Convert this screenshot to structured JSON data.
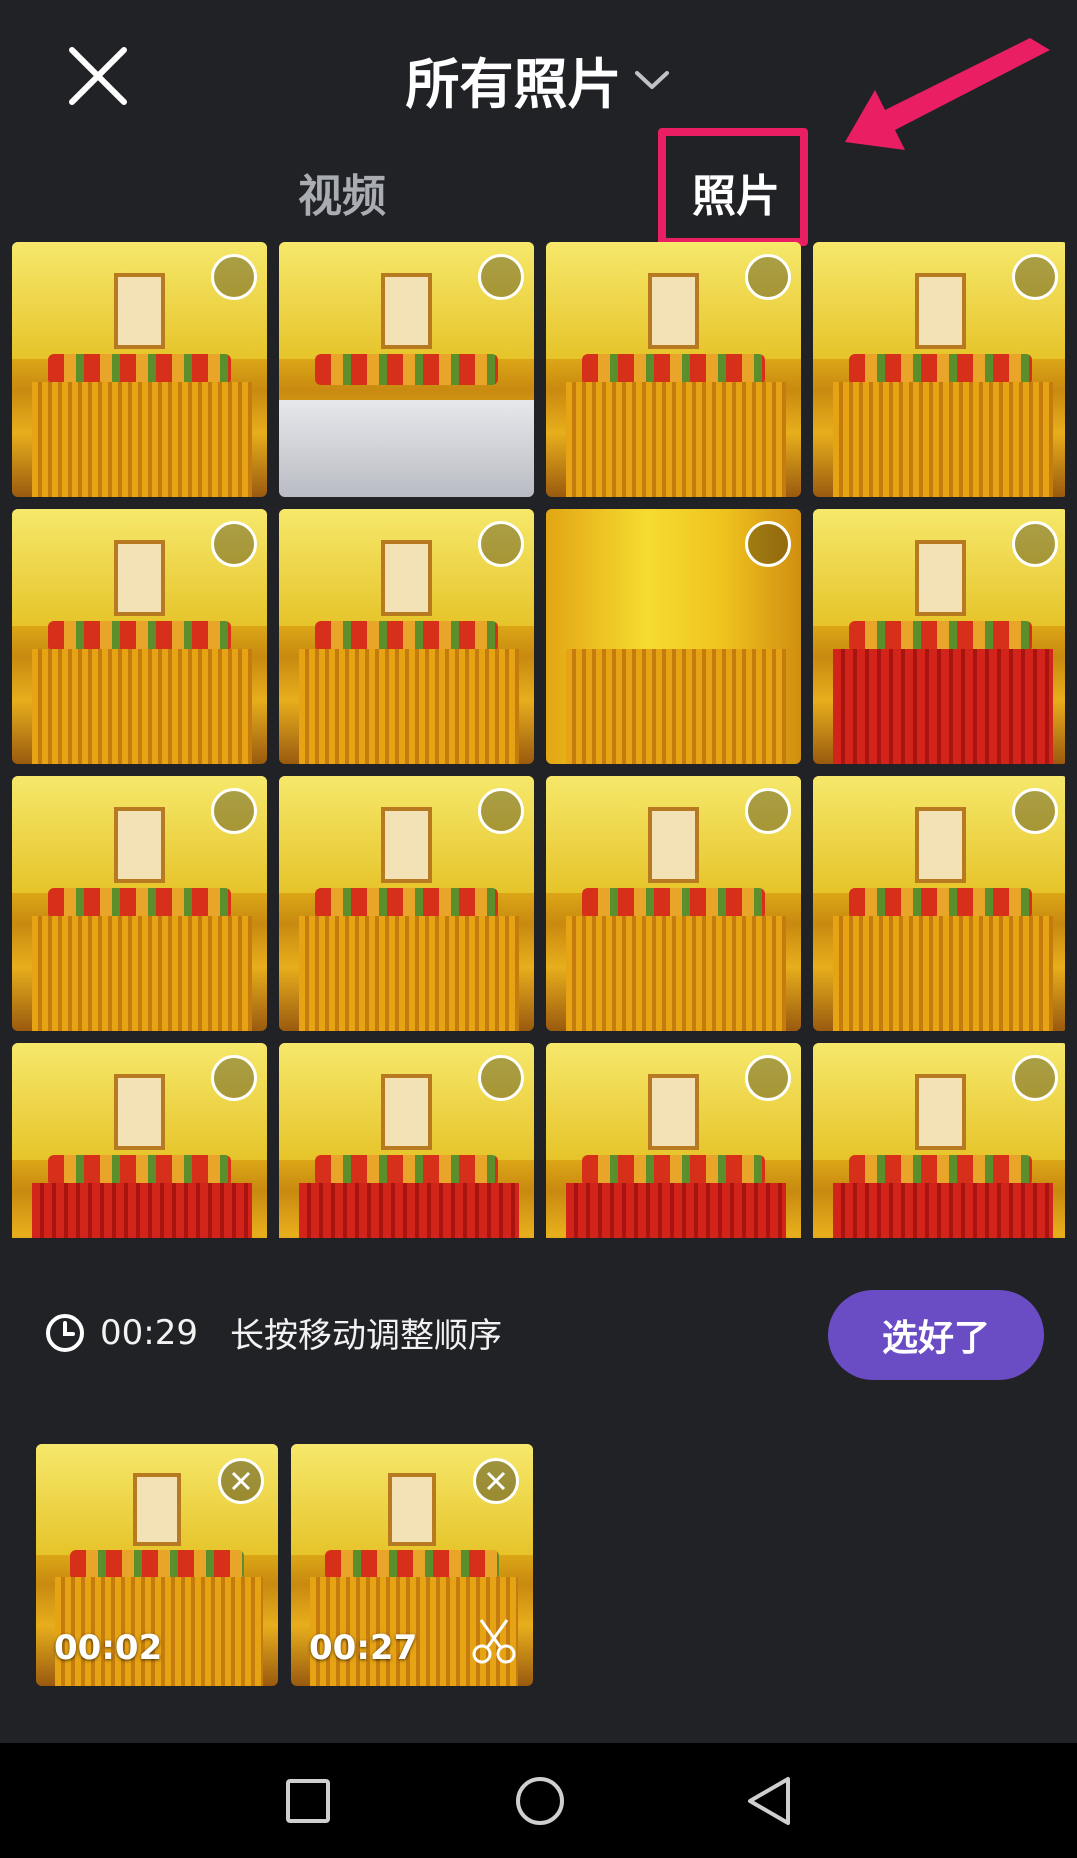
{
  "header": {
    "title": "所有照片",
    "close_icon": "close-icon",
    "dropdown_icon": "chevron-down-icon"
  },
  "tabs": [
    {
      "label": "视频",
      "active": false
    },
    {
      "label": "照片",
      "active": true
    }
  ],
  "colors": {
    "accent": "#6a4dc5",
    "highlight": "#e91e63",
    "background": "#212226"
  },
  "grid": {
    "photos": [
      {
        "style": "shrine"
      },
      {
        "style": "white"
      },
      {
        "style": "shrine"
      },
      {
        "style": "shrine"
      },
      {
        "style": "shrine"
      },
      {
        "style": "shrine"
      },
      {
        "style": "curtain"
      },
      {
        "style": "red"
      },
      {
        "style": "shrine"
      },
      {
        "style": "shrine"
      },
      {
        "style": "shrine"
      },
      {
        "style": "shrine"
      },
      {
        "style": "red"
      },
      {
        "style": "red"
      },
      {
        "style": "red"
      },
      {
        "style": "red"
      }
    ]
  },
  "footer": {
    "total_duration": "00:29",
    "hint": "长按移动调整顺序",
    "done_label": "选好了",
    "selected": [
      {
        "duration": "00:02",
        "trim": false
      },
      {
        "duration": "00:27",
        "trim": true
      }
    ]
  },
  "navbar": {
    "buttons": [
      "recents-icon",
      "home-icon",
      "back-icon"
    ]
  }
}
